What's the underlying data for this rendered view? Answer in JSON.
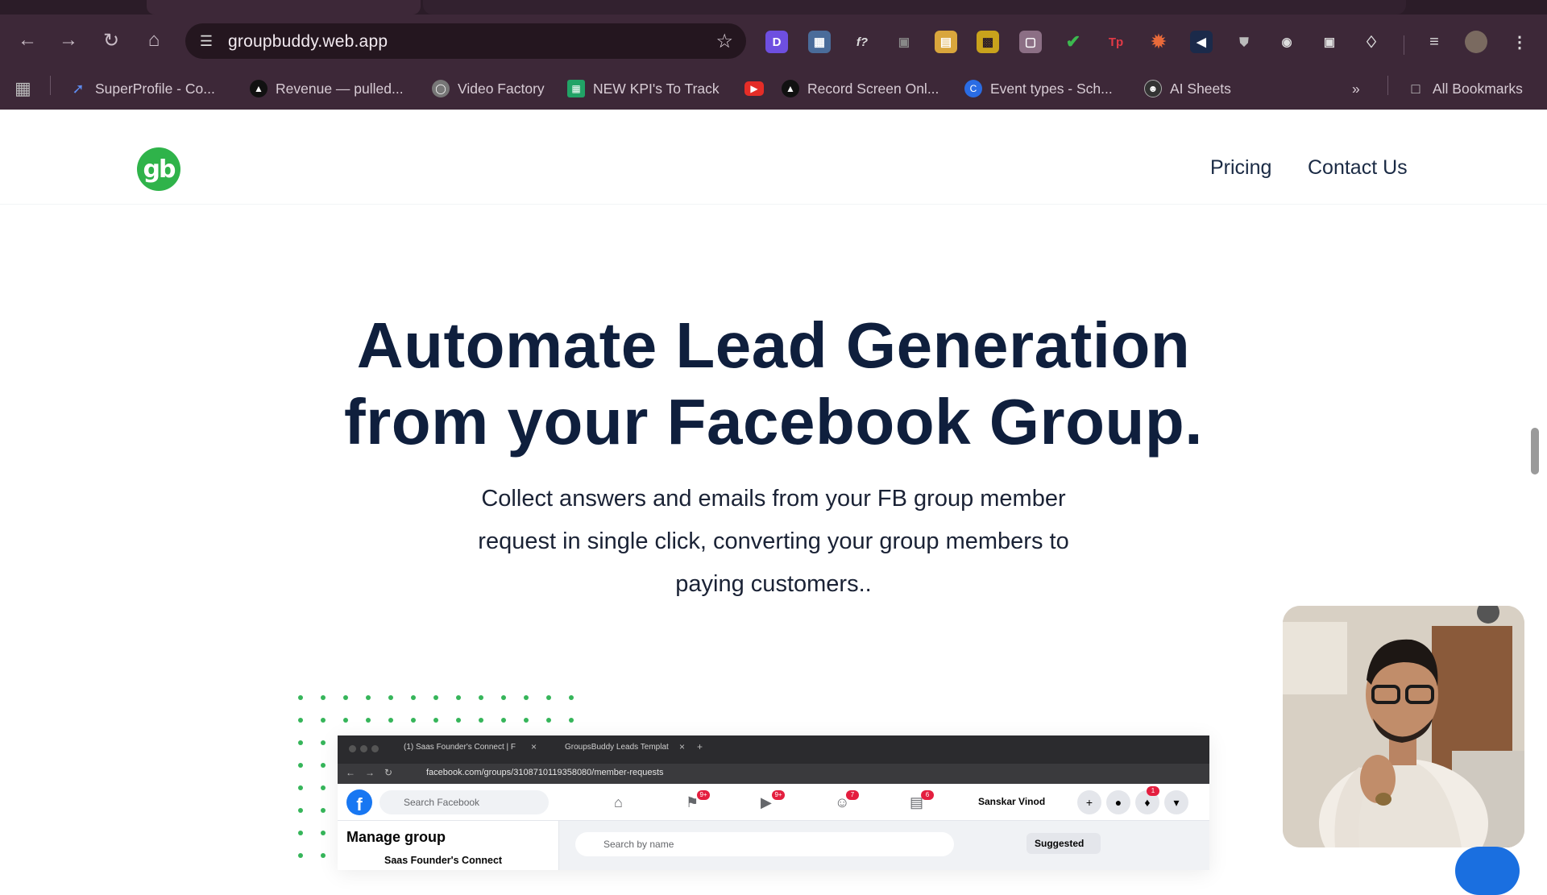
{
  "browser": {
    "url": "groupbuddy.web.app",
    "bookmarks": [
      {
        "label": "SuperProfile - Co...",
        "icon": "superprofile-icon"
      },
      {
        "label": "Revenue — pulled...",
        "icon": "triangle-icon"
      },
      {
        "label": "Video Factory",
        "icon": "globe-icon"
      },
      {
        "label": "NEW KPI's To Track",
        "icon": "sheets-icon"
      },
      {
        "label": "",
        "icon": "youtube-icon"
      },
      {
        "label": "Record Screen Onl...",
        "icon": "triangle-icon"
      },
      {
        "label": "Event types - Sch...",
        "icon": "calendly-icon"
      },
      {
        "label": "AI Sheets",
        "icon": "ai-sheets-icon"
      }
    ],
    "all_bookmarks": "All Bookmarks",
    "overflow_glyph": "»"
  },
  "site": {
    "logo_text": "gb",
    "nav": {
      "pricing": "Pricing",
      "contact": "Contact Us"
    },
    "hero": {
      "title_line1": "Automate Lead Generation",
      "title_line2": "from your Facebook Group.",
      "subtitle": "Collect answers and emails from your FB group member request in single click, converting your group members to paying customers.."
    }
  },
  "screenshot": {
    "tab1": "(1) Saas Founder's Connect | F",
    "tab2": "GroupsBuddy Leads Templat",
    "url": "facebook.com/groups/310871011935808​0/member-requests",
    "fb_search_placeholder": "Search Facebook",
    "user_name": "Sanskar Vinod",
    "badges": [
      "9+",
      "9+",
      "7",
      "6"
    ],
    "notif_badge": "1",
    "manage_group": "Manage group",
    "group_name": "Saas Founder's Connect",
    "search_by_name": "Search by name",
    "sort_label": "Suggested"
  },
  "colors": {
    "brand_green": "#2fb34a",
    "heading_navy": "#0f1f3d",
    "chrome_bg": "#3d2838"
  }
}
